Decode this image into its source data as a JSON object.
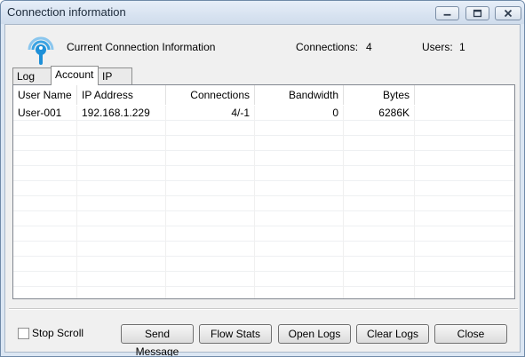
{
  "window": {
    "title": "Connection information"
  },
  "header": {
    "label": "Current Connection Information",
    "connections_label": "Connections:",
    "connections_value": "4",
    "users_label": "Users:",
    "users_value": "1"
  },
  "tabs": [
    {
      "label": "Log",
      "active": false
    },
    {
      "label": "Account",
      "active": true
    },
    {
      "label": "IP",
      "active": false
    }
  ],
  "table": {
    "columns": [
      "User Name",
      "IP Address",
      "Connections",
      "Bandwidth",
      "Bytes"
    ],
    "rows": [
      [
        "User-001",
        "192.168.1.229",
        "4/-1",
        "0",
        "6286K"
      ]
    ]
  },
  "footer": {
    "stop_scroll_label": "Stop Scroll",
    "stop_scroll_checked": false,
    "buttons": [
      "Send Message",
      "Flow Stats",
      "Open Logs",
      "Clear Logs",
      "Close"
    ]
  },
  "colors": {
    "icon_blue": "#1e90d8",
    "title_text": "#1c2a3a"
  }
}
